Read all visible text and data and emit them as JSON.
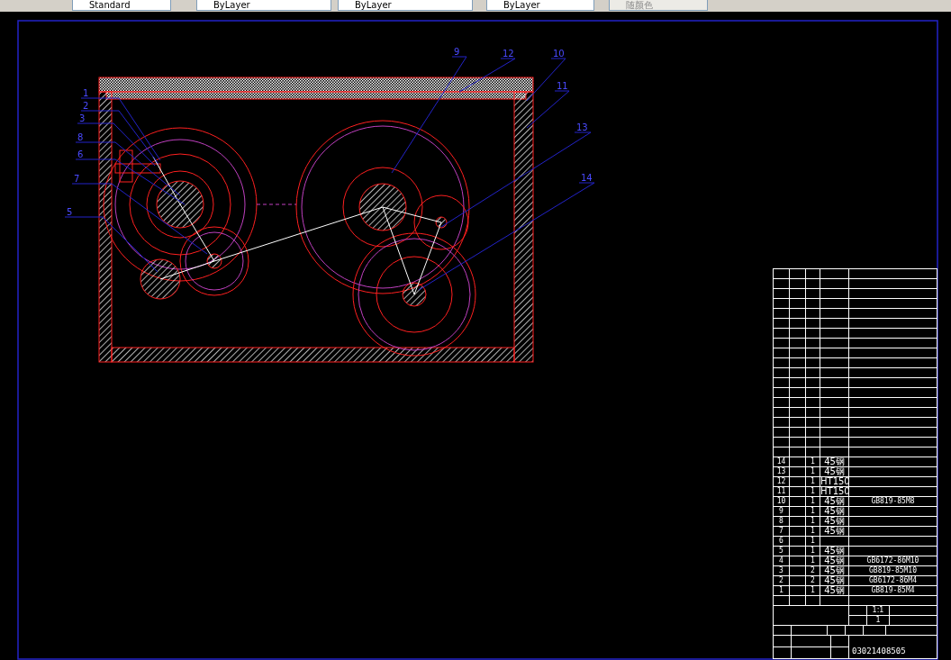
{
  "toolbar": {
    "controls": [
      {
        "text": "Standard",
        "disabled": false
      },
      {
        "text": "ByLayer",
        "disabled": false
      },
      {
        "text": "ByLayer",
        "disabled": false
      },
      {
        "text": "ByLayer",
        "disabled": false
      },
      {
        "text": "随颜色",
        "disabled": true
      }
    ]
  },
  "drawing": {
    "leader_labels": [
      {
        "text": "1"
      },
      {
        "text": "2"
      },
      {
        "text": "3"
      },
      {
        "text": "8"
      },
      {
        "text": "6"
      },
      {
        "text": "7"
      },
      {
        "text": "5"
      },
      {
        "text": "9"
      },
      {
        "text": "12"
      },
      {
        "text": "10"
      },
      {
        "text": "11"
      },
      {
        "text": "13"
      },
      {
        "text": "14"
      }
    ]
  },
  "parts_list": {
    "rows": [
      {
        "no": "14",
        "qty": "1",
        "material": "45钢",
        "standard": ""
      },
      {
        "no": "13",
        "qty": "1",
        "material": "45钢",
        "standard": ""
      },
      {
        "no": "12",
        "qty": "1",
        "material": "HT150",
        "standard": ""
      },
      {
        "no": "11",
        "qty": "1",
        "material": "HT150",
        "standard": ""
      },
      {
        "no": "10",
        "qty": "1",
        "material": "45钢",
        "standard": "GB819-85M8"
      },
      {
        "no": "9",
        "qty": "1",
        "material": "45钢",
        "standard": ""
      },
      {
        "no": "8",
        "qty": "1",
        "material": "45钢",
        "standard": ""
      },
      {
        "no": "7",
        "qty": "1",
        "material": "45钢",
        "standard": ""
      },
      {
        "no": "6",
        "qty": "1",
        "material": "",
        "standard": ""
      },
      {
        "no": "5",
        "qty": "1",
        "material": "45钢",
        "standard": ""
      },
      {
        "no": "4",
        "qty": "1",
        "material": "45钢",
        "standard": "GB6172-86M10"
      },
      {
        "no": "3",
        "qty": "2",
        "material": "45钢",
        "standard": "GB819-85M10"
      },
      {
        "no": "2",
        "qty": "2",
        "material": "45钢",
        "standard": "GB6172-86M4"
      },
      {
        "no": "1",
        "qty": "1",
        "material": "45钢",
        "standard": "GB819-85M4"
      }
    ]
  },
  "title_block": {
    "scale": "1:1",
    "quantity": "1",
    "drawing_number": "03021408505"
  }
}
